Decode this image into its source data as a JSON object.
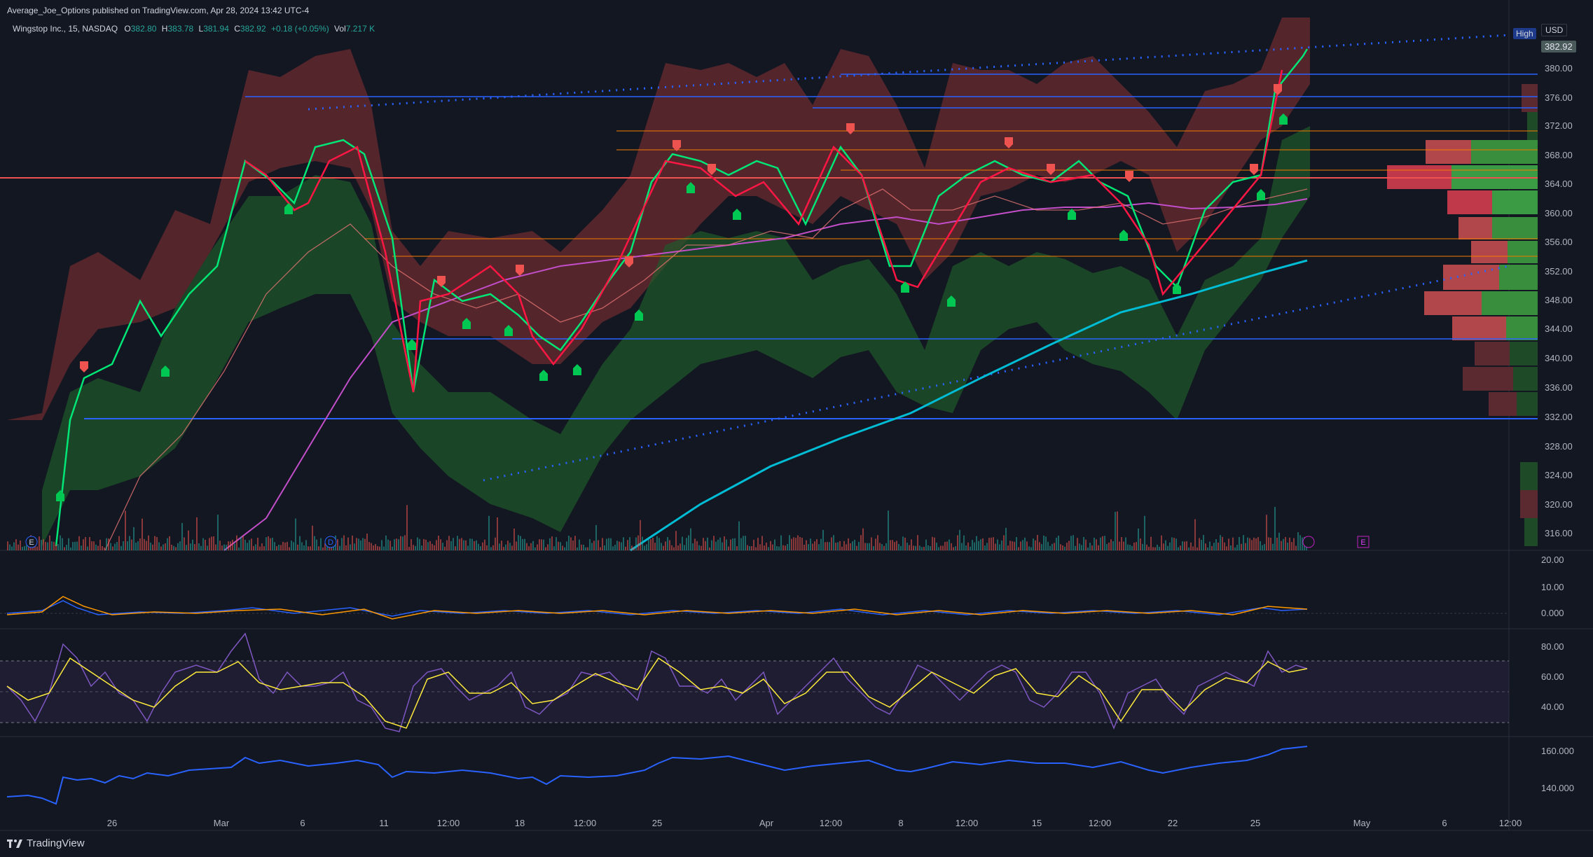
{
  "publisher": "Average_Joe_Options published on TradingView.com, Apr 28, 2024 13:42 UTC-4",
  "symbol": {
    "name": "Wingstop Inc., 15, NASDAQ",
    "o_label": "O",
    "o": "382.80",
    "h_label": "H",
    "h": "383.78",
    "l_label": "L",
    "l": "381.94",
    "c_label": "C",
    "c": "382.92",
    "change": "+0.18 (+0.05%)",
    "vol_label": "Vol",
    "vol": "7.217 K"
  },
  "currency": "USD",
  "high_tag": "High",
  "last_price": "382.92",
  "price_axis": [
    "380.00",
    "376.00",
    "372.00",
    "368.00",
    "364.00",
    "360.00",
    "356.00",
    "352.00",
    "348.00",
    "344.00",
    "340.00",
    "336.00",
    "332.00",
    "328.00",
    "324.00",
    "320.00",
    "316.00"
  ],
  "macd_axis": [
    "20.00",
    "10.00",
    "0.000"
  ],
  "rsi_axis": [
    "80.00",
    "60.00",
    "40.00"
  ],
  "obv_axis": [
    "160.000",
    "140.000"
  ],
  "time_axis": [
    "26",
    "Mar",
    "6",
    "11",
    "12:00",
    "18",
    "12:00",
    "25",
    "Apr",
    "12:00",
    "8",
    "12:00",
    "15",
    "12:00",
    "22",
    "25",
    "May",
    "6",
    "12:00"
  ],
  "event_markers": [
    "E",
    "D",
    "E"
  ],
  "branding": "TradingView",
  "colors": {
    "background": "#131722",
    "bull": "#26a69a",
    "bear": "#ef5350",
    "fast_ma_up": "#00e676",
    "fast_ma_down": "#ff1744",
    "ma200": "#00bcd4",
    "level_line": "#2962ff",
    "rsi": "#7e57c2",
    "rsi_signal": "#ffeb3b",
    "obv": "#2962ff",
    "upper_band": "#b2474b",
    "lower_band": "#2e7d32"
  },
  "icons": [
    "tradingview-logo-icon",
    "flash-icon"
  ]
}
